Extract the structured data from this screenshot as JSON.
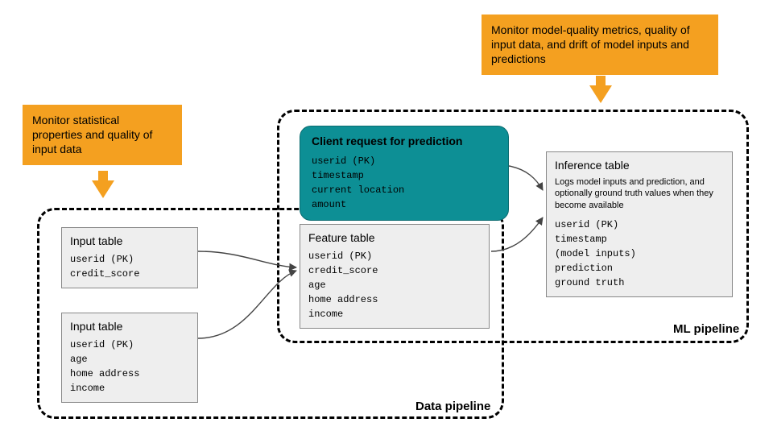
{
  "callouts": {
    "left": "Monitor statistical properties and quality of input data",
    "right": "Monitor model-quality metrics, quality of input data, and drift of model inputs and predictions"
  },
  "pipelines": {
    "data_label": "Data pipeline",
    "ml_label": "ML pipeline"
  },
  "input_table_1": {
    "title": "Input table",
    "fields": "userid (PK)\ncredit_score"
  },
  "input_table_2": {
    "title": "Input table",
    "fields": "userid (PK)\nage\nhome address\nincome"
  },
  "feature_table": {
    "title": "Feature table",
    "fields": "userid (PK)\ncredit_score\nage\nhome address\nincome"
  },
  "client_request": {
    "title": "Client request for prediction",
    "fields": "userid (PK)\ntimestamp\ncurrent location\namount"
  },
  "inference_table": {
    "title": "Inference table",
    "desc": "Logs model inputs and prediction, and optionally ground truth values when they become available",
    "fields": "userid (PK)\ntimestamp\n(model inputs)\nprediction\nground truth"
  },
  "colors": {
    "callout_bg": "#f4a020",
    "client_bg": "#0d8f95",
    "table_bg": "#eeeeee"
  }
}
